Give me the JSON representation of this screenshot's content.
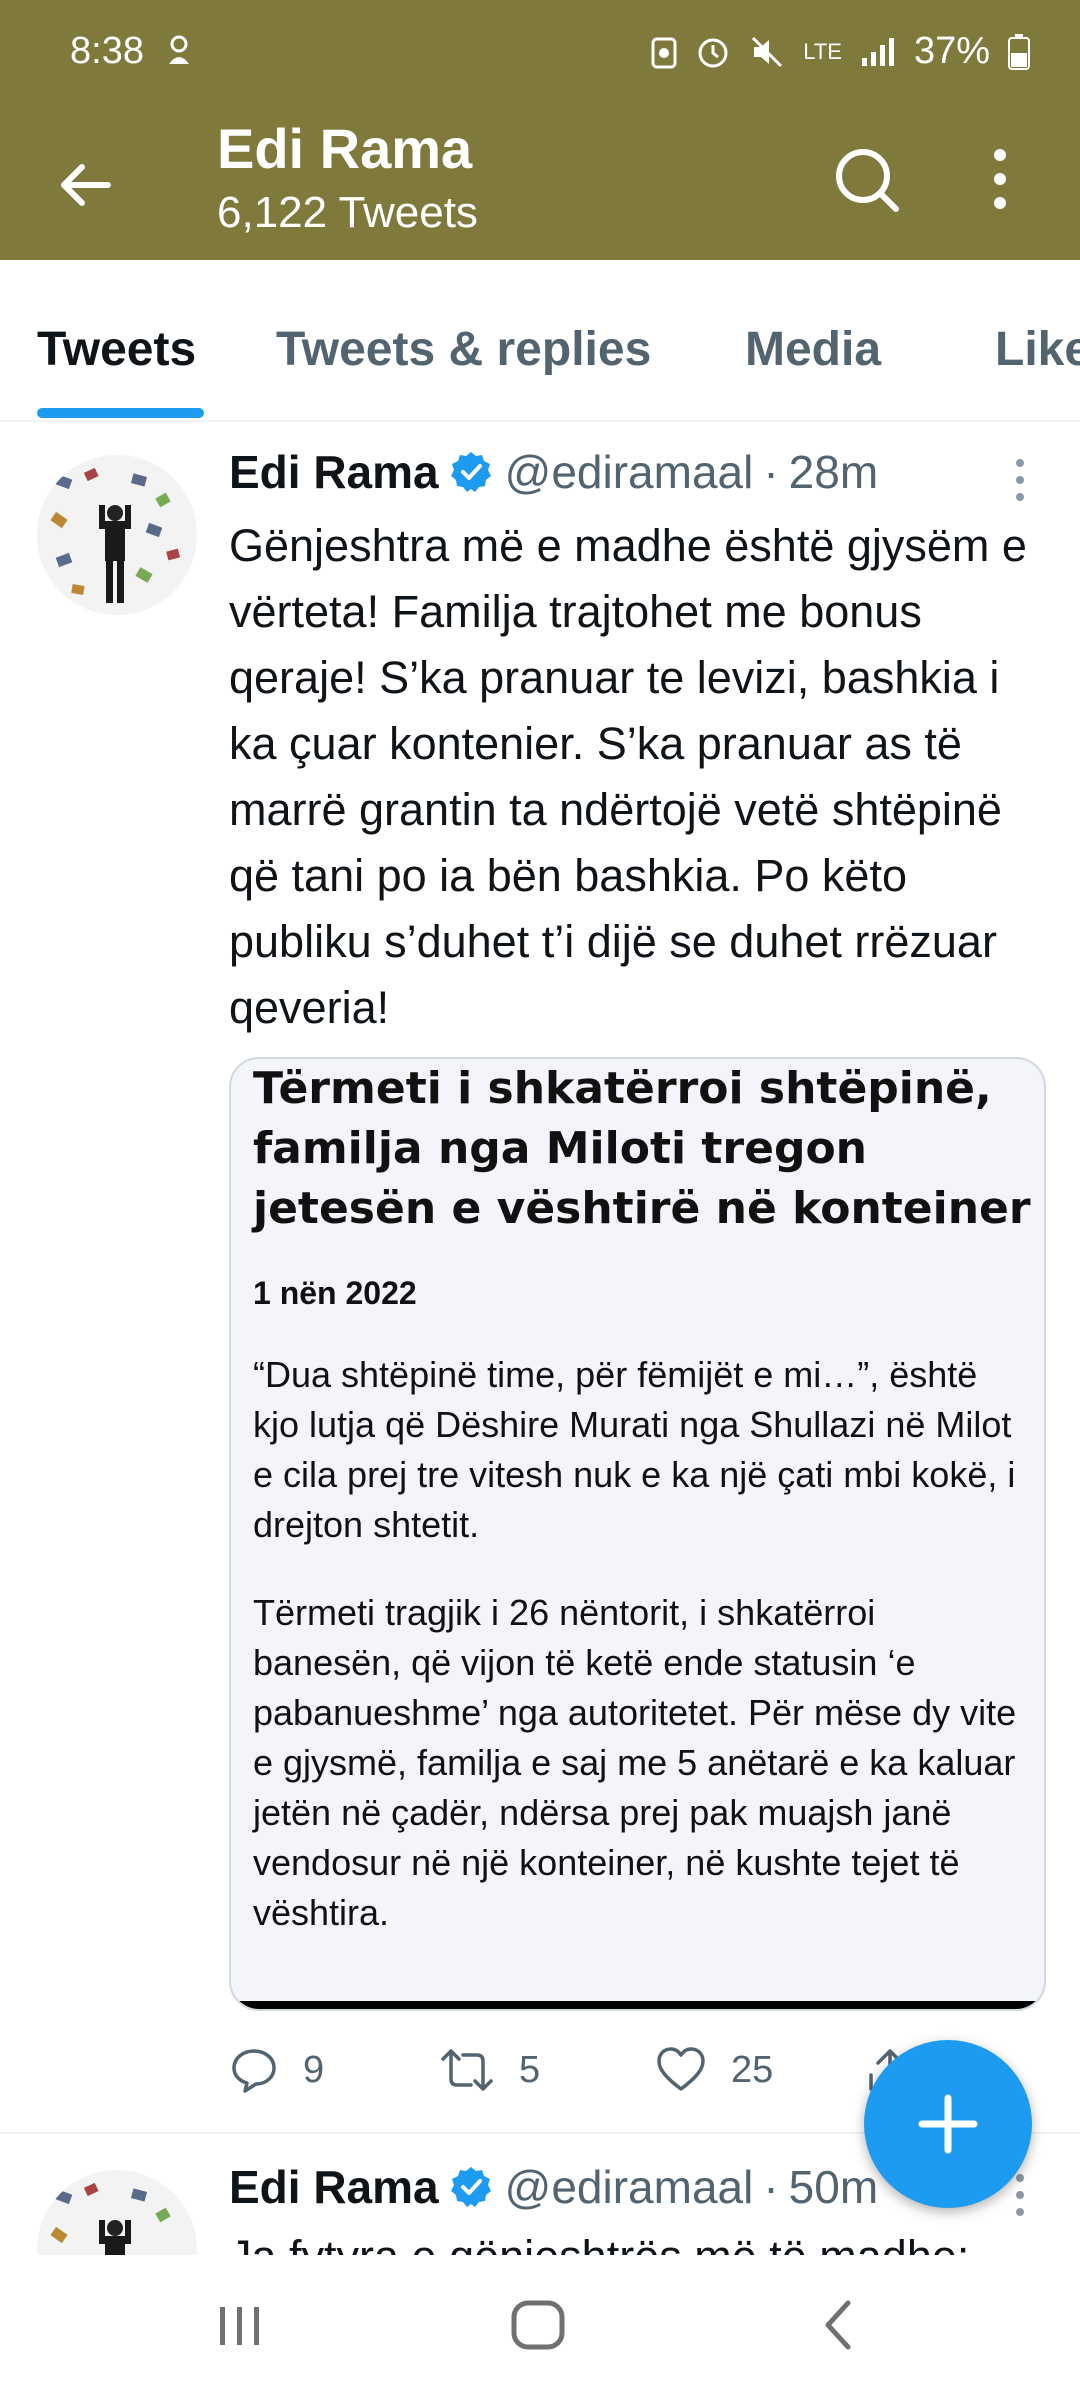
{
  "status_bar": {
    "time": "8:38",
    "network": "LTE",
    "battery": "37%"
  },
  "header": {
    "title": "Edi Rama",
    "subtitle": "6,122 Tweets"
  },
  "tabs": [
    {
      "label": "Tweets",
      "active": true
    },
    {
      "label": "Tweets & replies",
      "active": false
    },
    {
      "label": "Media",
      "active": false
    },
    {
      "label": "Like",
      "active": false
    }
  ],
  "tweets": [
    {
      "name": "Edi Rama",
      "handle": "@ediramaal",
      "sep": "·",
      "time": "28m",
      "text": "Gënjeshtra më e madhe është gjysëm e vërteta! Familja trajtohet me bonus qeraje! S’ka pranuar te levizi, bashkia i ka çuar kontenier. S’ka pranuar as të marrë grantin ta ndërtojë vetë shtëpinë që tani po ia bën bashkia. Po këto publiku s’duhet t’i dijë se duhet rrëzuar qeveria!",
      "media": {
        "headline": "Tërmeti i shkatërroi shtëpinë, familja nga Miloti tregon jetesën e vështirë në konteiner",
        "date": "1 nën 2022",
        "paragraph1": "“Dua shtëpinë time, për fëmijët e mi…”, është kjo lutja që Dëshire Murati nga Shullazi në Milot e cila prej tre vitesh nuk e ka një çati mbi kokë, i drejton shtetit.",
        "paragraph2": "Tërmeti tragjik i 26 nëntorit, i shkatërroi banesën, që vijon të ketë ende statusin ‘e pabanueshme’ nga autoritetet. Për mëse dy vite e gjysmë, familja e saj me 5 anëtarë e ka kaluar jetën në çadër, ndërsa prej pak muajsh janë vendosur në një konteiner, në kushte tejet të vështira."
      },
      "replies": "9",
      "retweets": "5",
      "likes": "25"
    },
    {
      "name": "Edi Rama",
      "handle": "@ediramaal",
      "sep": "·",
      "time": "50m",
      "text": "Ja fytyra e gënjeshtrës më të madhe:"
    }
  ],
  "colors": {
    "header_bg": "#7f7a3c",
    "accent": "#1d9bf0"
  },
  "icons": [
    "back-arrow-icon",
    "search-icon",
    "more-vertical-icon",
    "verified-badge-icon",
    "reply-icon",
    "retweet-icon",
    "like-icon",
    "share-icon",
    "plus-icon",
    "recents-icon",
    "home-icon",
    "back-nav-icon"
  ]
}
